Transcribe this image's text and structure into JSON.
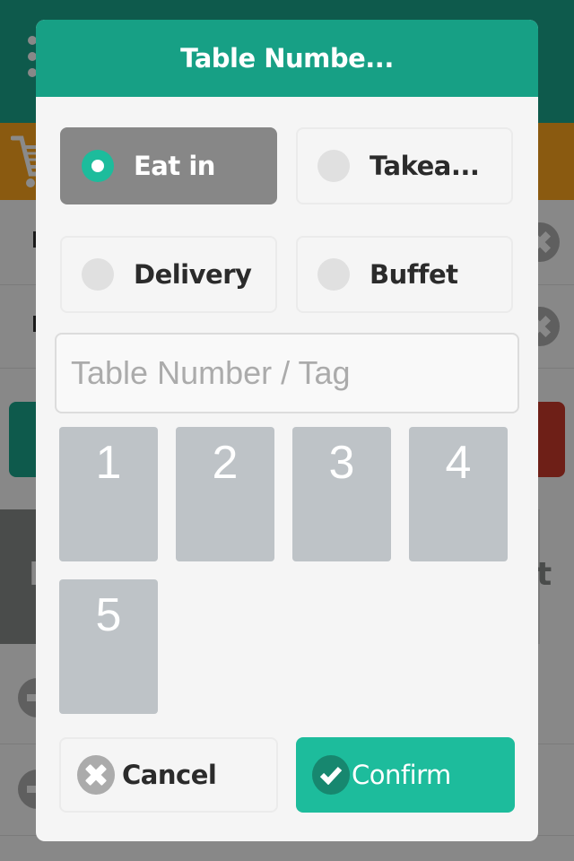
{
  "background": {
    "band_left_text": "E",
    "band_right_text": "t"
  },
  "modal": {
    "title": "Table Numbe...",
    "order_types": [
      {
        "label": "Eat in",
        "selected": true
      },
      {
        "label": "Takea...",
        "selected": false
      },
      {
        "label": "Delivery",
        "selected": false
      },
      {
        "label": "Buffet",
        "selected": false
      }
    ],
    "table_input": {
      "value": "",
      "placeholder": "Table Number / Tag"
    },
    "tables": [
      "1",
      "2",
      "3",
      "4",
      "5"
    ],
    "cancel_label": "Cancel",
    "confirm_label": "Confirm",
    "icons": {
      "cancel": "close-circle-icon",
      "confirm": "check-circle-icon"
    }
  },
  "colors": {
    "header_teal": "#17a085",
    "accent_green": "#1dbc9c",
    "selected_card": "#878787",
    "tile_grey": "#bec3c7"
  }
}
